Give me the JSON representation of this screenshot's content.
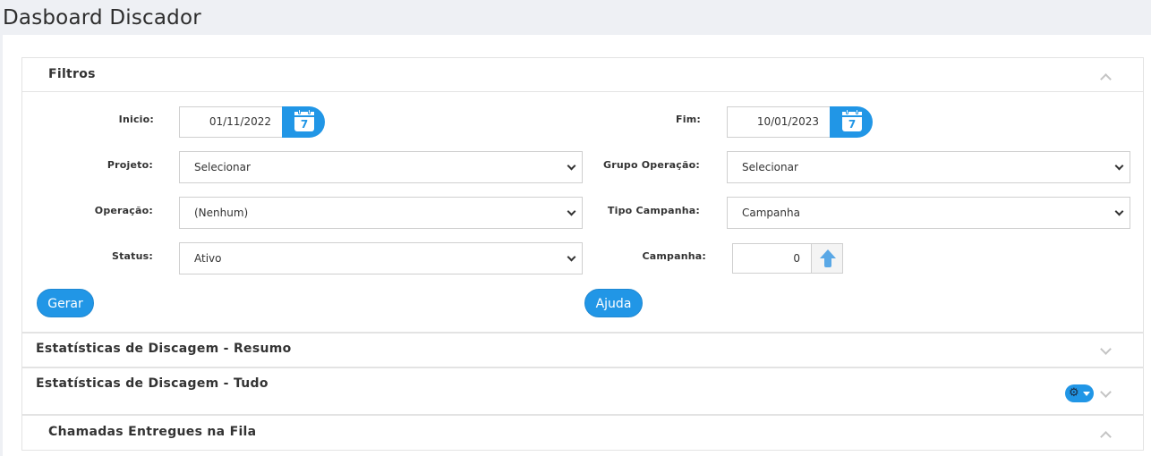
{
  "page": {
    "title": "Dasboard Discador"
  },
  "filters": {
    "title": "Filtros",
    "inicio": {
      "label": "Inicio:",
      "value": "01/11/2022",
      "calendar_day": "7"
    },
    "fim": {
      "label": "Fim:",
      "value": "10/01/2023",
      "calendar_day": "7"
    },
    "projeto": {
      "label": "Projeto:",
      "value": "Selecionar"
    },
    "grupo_operacao": {
      "label": "Grupo Operação:",
      "value": "Selecionar"
    },
    "operacao": {
      "label": "Operação:",
      "value": "(Nenhum)"
    },
    "tipo_campanha": {
      "label": "Tipo Campanha:",
      "value": "Campanha"
    },
    "status": {
      "label": "Status:",
      "value": "Ativo"
    },
    "campanha": {
      "label": "Campanha:",
      "value": "0"
    },
    "gerar_label": "Gerar",
    "ajuda_label": "Ajuda"
  },
  "sections": {
    "resumo": {
      "title": "Estatísticas de Discagem - Resumo"
    },
    "tudo": {
      "title": "Estatísticas de Discagem - Tudo"
    },
    "fila": {
      "title": "Chamadas Entregues na Fila"
    }
  },
  "colors": {
    "accent": "#2196e6",
    "header_bg": "#eef0f4",
    "border": "#e3e3e3"
  },
  "icons": [
    "calendar-icon",
    "chevron-up-icon",
    "chevron-down-icon",
    "arrow-up-icon",
    "gear-icon",
    "caret-down-icon"
  ]
}
